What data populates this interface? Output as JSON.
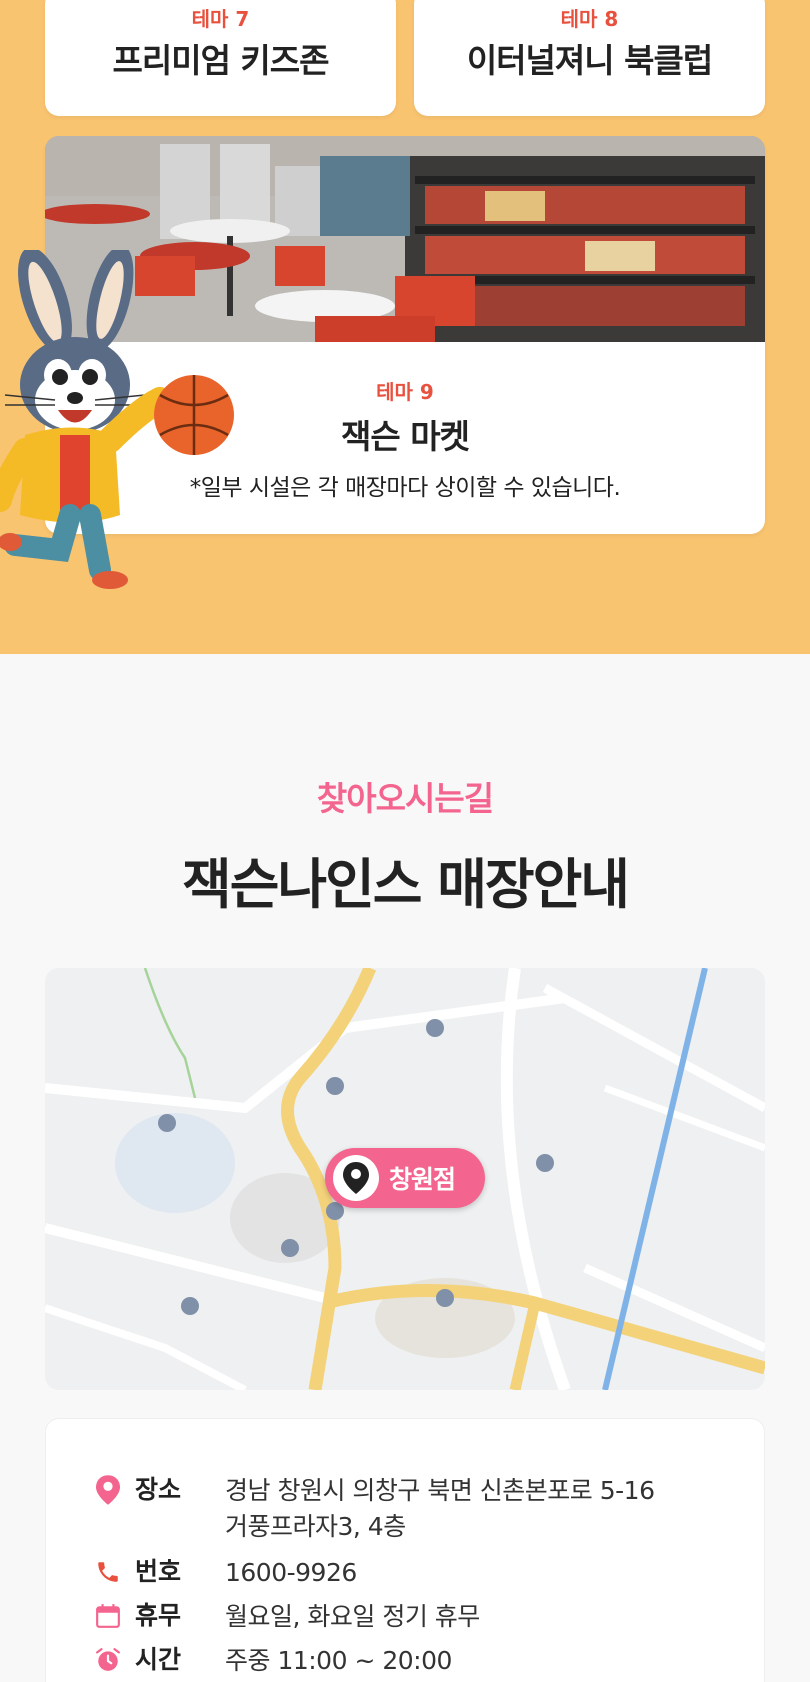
{
  "themes": {
    "t7": {
      "num": "테마 7",
      "name": "프리미엄 키즈존"
    },
    "t8": {
      "num": "테마 8",
      "name": "이터널져니 북클럽"
    },
    "t9": {
      "num": "테마 9",
      "name": "잭슨 마켓",
      "note": "*일부 시설은 각 매장마다 상이할 수 있습니다."
    }
  },
  "directions": {
    "eyebrow": "찾아오시는길",
    "title": "잭슨나인스 매장안내",
    "map_pin_label": "창원점"
  },
  "info": {
    "place": {
      "icon": "location-pin-icon",
      "label": "장소",
      "line1": "경남 창원시 의창구 북면 신촌본포로 5-16",
      "line2": "거풍프라자3, 4층"
    },
    "phone": {
      "icon": "phone-icon",
      "label": "번호",
      "value": "1600-9926"
    },
    "closed": {
      "icon": "calendar-icon",
      "label": "휴무",
      "value": "월요일, 화요일 정기 휴무"
    },
    "hours": {
      "icon": "alarm-clock-icon",
      "label": "시간",
      "value": "주중 11:00 ~ 20:00"
    }
  },
  "colors": {
    "theme_bg": "#f9c470",
    "accent_red": "#e8513e",
    "accent_pink": "#f3658f"
  }
}
